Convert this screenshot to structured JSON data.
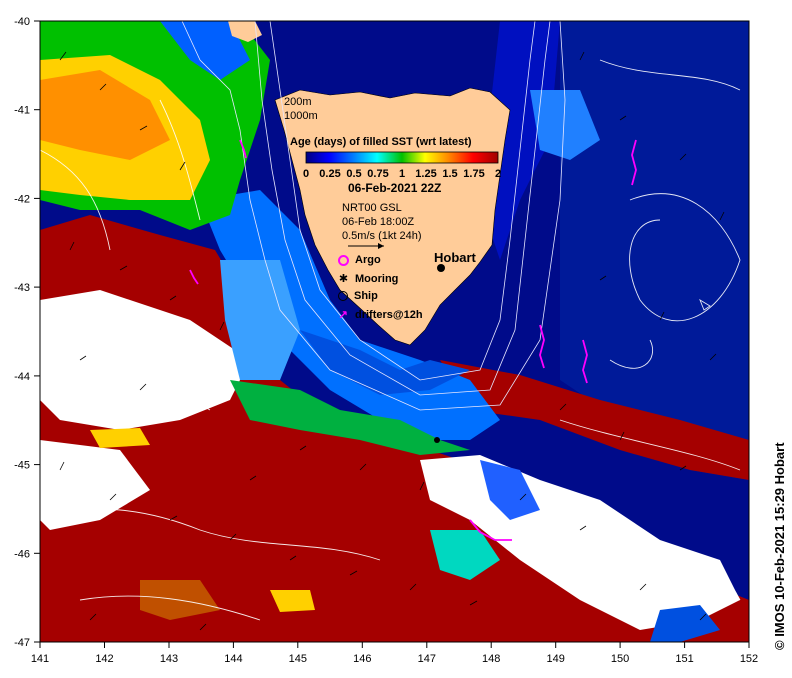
{
  "map": {
    "lon_range": [
      141,
      152
    ],
    "lat_range": [
      -47,
      -40
    ],
    "x_ticks": [
      "141",
      "142",
      "143",
      "144",
      "145",
      "146",
      "147",
      "148",
      "149",
      "150",
      "151",
      "152"
    ],
    "y_ticks": [
      "-40",
      "-41",
      "-42",
      "-43",
      "-44",
      "-45",
      "-46",
      "-47"
    ]
  },
  "labels": {
    "depth_200": "200m",
    "depth_1000": "1000m",
    "colorbar_title": "Age (days) of filled SST (wrt latest)",
    "colorbar_ticks": [
      "0",
      "0.25",
      "0.5",
      "0.75",
      "1",
      "1.25",
      "1.5",
      "1.75",
      "2"
    ],
    "date": "06-Feb-2021 22Z",
    "currents_source": "NRT00 GSL",
    "currents_time": "06-Feb 18:00Z",
    "scale_text": "0.5m/s (1kt 24h)",
    "city": "Hobart",
    "credit": "© IMOS 10-Feb-2021 15:29 Hobart"
  },
  "legend": [
    {
      "label": "Argo",
      "icon": "argo-icon"
    },
    {
      "label": "Mooring",
      "icon": "mooring-icon"
    },
    {
      "label": "Ship",
      "icon": "ship-icon"
    },
    {
      "label": "drifters@12h",
      "icon": "drifter-icon"
    }
  ],
  "colors": {
    "age_scale": [
      "#000080",
      "#0000ff",
      "#0080ff",
      "#00ffff",
      "#00c000",
      "#ffff00",
      "#ff8000",
      "#ff0000",
      "#a00000"
    ],
    "land": "#ffcc99",
    "no_data": "#ffffff",
    "drifter": "#ff00ff"
  }
}
